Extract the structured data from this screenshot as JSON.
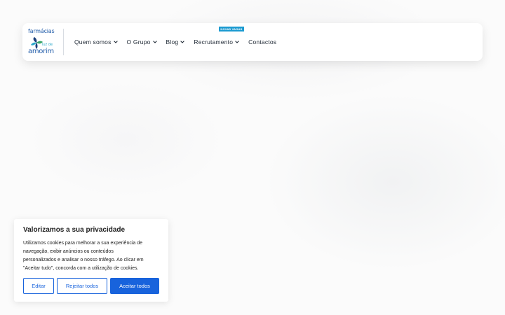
{
  "logo": {
    "top_text": "farmácias",
    "mid_text": "luz de",
    "bottom_text": "amorim",
    "colors": {
      "blue": "#1e5aa8",
      "teal": "#2aa7c9",
      "navy": "#1b3f7a",
      "green": "#3aa66a"
    }
  },
  "nav": {
    "items": [
      {
        "label": "Quem somos",
        "has_dropdown": true
      },
      {
        "label": "O Grupo",
        "has_dropdown": true
      },
      {
        "label": "Blog",
        "has_dropdown": true
      },
      {
        "label": "Recrutamento",
        "has_dropdown": true,
        "badge": "NOVAS VAGAS"
      },
      {
        "label": "Contactos",
        "has_dropdown": false
      }
    ],
    "chevron_icon": "chevron-down-icon"
  },
  "cookie": {
    "title": "Valorizamos a sua privacidade",
    "text_lines": [
      "Utilizamos cookies para melhorar a sua experiência de",
      "navegação, exibir anúncios ou conteúdos",
      "personalizados e analisar o nosso tráfego. Ao clicar em",
      "\"Aceitar tudo\", concorda com a utilização de cookies."
    ],
    "buttons": {
      "edit": "Editar",
      "reject": "Rejeitar todos",
      "accept": "Aceitar todos"
    },
    "accent_color": "#1863dc"
  }
}
